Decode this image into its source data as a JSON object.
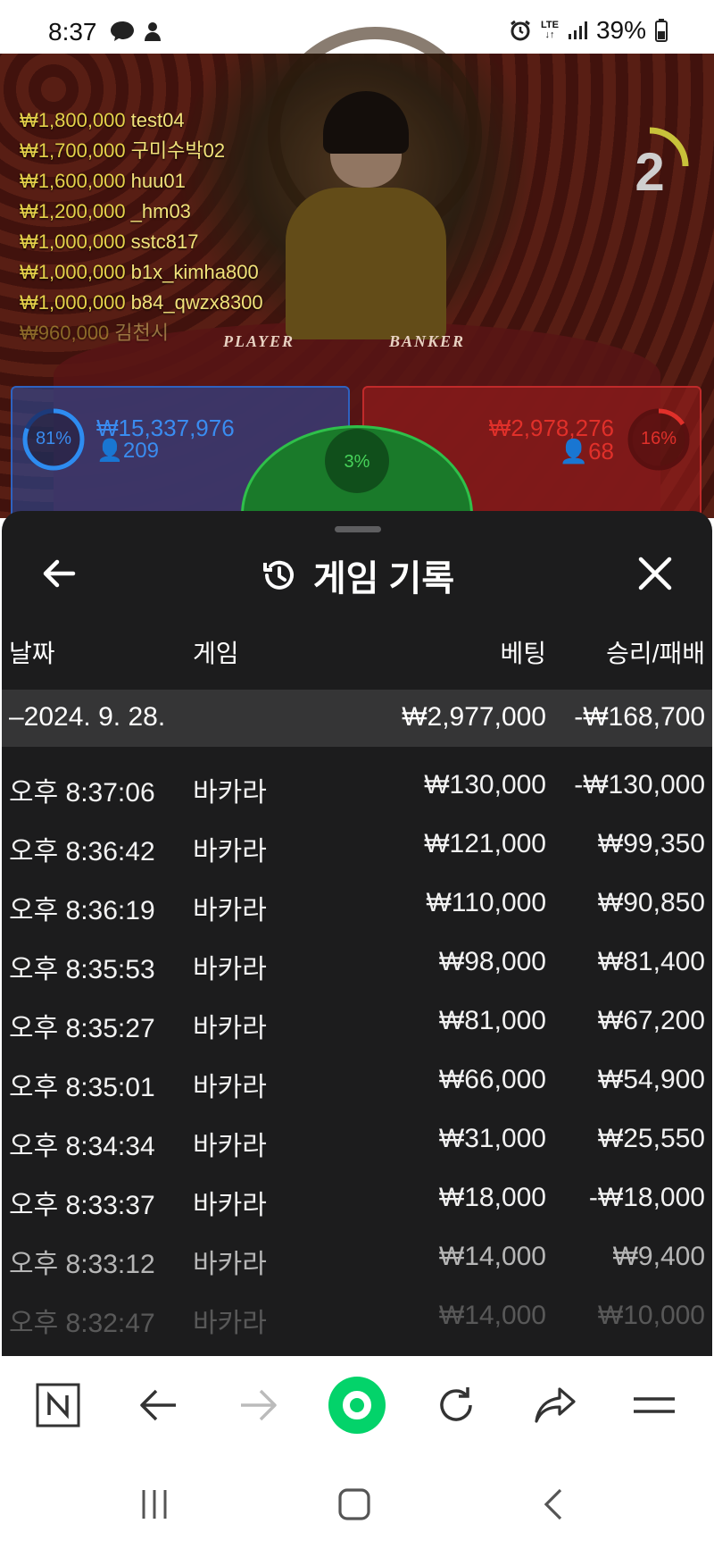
{
  "status_bar": {
    "time": "8:37",
    "battery": "39%",
    "network": "LTE",
    "icons": [
      "messenger-icon",
      "notification-icon",
      "alarm-icon",
      "lte-icon",
      "signal-icon",
      "battery-icon"
    ]
  },
  "live_game": {
    "countdown": "2",
    "table_labels": {
      "player": "PLAYER",
      "banker": "BANKER"
    },
    "bet_feed": [
      {
        "amount": "₩1,800,000",
        "user": "test04"
      },
      {
        "amount": "₩1,700,000",
        "user": "구미수박02"
      },
      {
        "amount": "₩1,600,000",
        "user": "huu01"
      },
      {
        "amount": "₩1,200,000",
        "user": "_hm03"
      },
      {
        "amount": "₩1,000,000",
        "user": "sstc817"
      },
      {
        "amount": "₩1,000,000",
        "user": "b1x_kimha800"
      },
      {
        "amount": "₩1,000,000",
        "user": "b84_qwzx8300"
      },
      {
        "amount": "₩960,000",
        "user": "김천시"
      }
    ],
    "player": {
      "percent": "81%",
      "amount": "₩15,337,976",
      "count": "209",
      "color": "#2e6fd8"
    },
    "banker": {
      "percent": "16%",
      "amount": "₩2,978,276",
      "count": "68",
      "color": "#e0302a"
    },
    "tie": {
      "percent": "3%",
      "color": "#2fc04a"
    }
  },
  "history_sheet": {
    "title": "게임 기록",
    "columns": {
      "date": "날짜",
      "game": "게임",
      "bet": "베팅",
      "result": "승리/패배"
    },
    "date_group": {
      "label": "–2024. 9. 28.",
      "total_bet": "₩2,977,000",
      "total_result": "-₩168,700"
    },
    "rows": [
      {
        "time": "오후 8:37:06",
        "game": "바카라",
        "bet": "₩130,000",
        "result": "-₩130,000"
      },
      {
        "time": "오후 8:36:42",
        "game": "바카라",
        "bet": "₩121,000",
        "result": "₩99,350"
      },
      {
        "time": "오후 8:36:19",
        "game": "바카라",
        "bet": "₩110,000",
        "result": "₩90,850"
      },
      {
        "time": "오후 8:35:53",
        "game": "바카라",
        "bet": "₩98,000",
        "result": "₩81,400"
      },
      {
        "time": "오후 8:35:27",
        "game": "바카라",
        "bet": "₩81,000",
        "result": "₩67,200"
      },
      {
        "time": "오후 8:35:01",
        "game": "바카라",
        "bet": "₩66,000",
        "result": "₩54,900"
      },
      {
        "time": "오후 8:34:34",
        "game": "바카라",
        "bet": "₩31,000",
        "result": "₩25,550"
      },
      {
        "time": "오후 8:33:37",
        "game": "바카라",
        "bet": "₩18,000",
        "result": "-₩18,000"
      },
      {
        "time": "오후 8:33:12",
        "game": "바카라",
        "bet": "₩14,000",
        "result": "₩9,400"
      },
      {
        "time": "오후 8:32:47",
        "game": "바카라",
        "bet": "₩14,000",
        "result": "₩10,000"
      }
    ]
  },
  "browser_toolbar": {
    "icons": [
      "naver-logo-icon",
      "back-arrow-icon",
      "forward-arrow-icon",
      "green-dot-icon",
      "refresh-icon",
      "share-icon",
      "menu-icon"
    ],
    "accent": "#03d36a"
  },
  "system_nav": {
    "icons": [
      "recent-apps-icon",
      "home-icon",
      "back-icon"
    ]
  }
}
